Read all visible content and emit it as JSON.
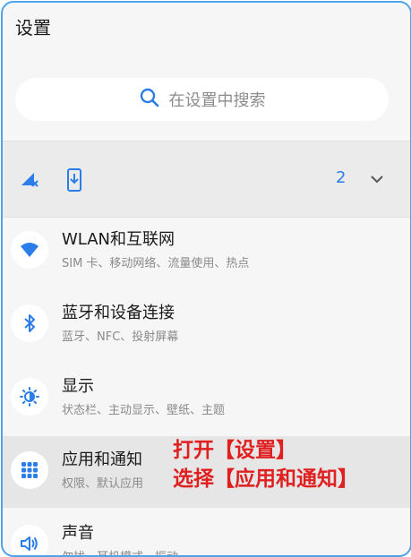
{
  "header": {
    "title": "设置"
  },
  "search": {
    "placeholder": "在设置中搜索"
  },
  "quick_bar": {
    "count": "2"
  },
  "items": [
    {
      "title": "WLAN和互联网",
      "subtitle": "SIM 卡、移动网络、流量使用、热点",
      "icon": "wifi-icon"
    },
    {
      "title": "蓝牙和设备连接",
      "subtitle": "蓝牙、NFC、投射屏幕",
      "icon": "bluetooth-icon"
    },
    {
      "title": "显示",
      "subtitle": "状态栏、主动显示、壁纸、主题",
      "icon": "brightness-icon"
    },
    {
      "title": "应用和通知",
      "subtitle": "权限、默认应用",
      "icon": "apps-grid-icon"
    },
    {
      "title": "声音",
      "subtitle": "勿扰、耳机模式、振动",
      "icon": "speaker-icon"
    }
  ],
  "annotation": {
    "line1": "打开【设置】",
    "line2": "选择【应用和通知】"
  },
  "colors": {
    "accent": "#2b7de9",
    "annotation": "#e02020",
    "border": "#4fa3e8"
  }
}
